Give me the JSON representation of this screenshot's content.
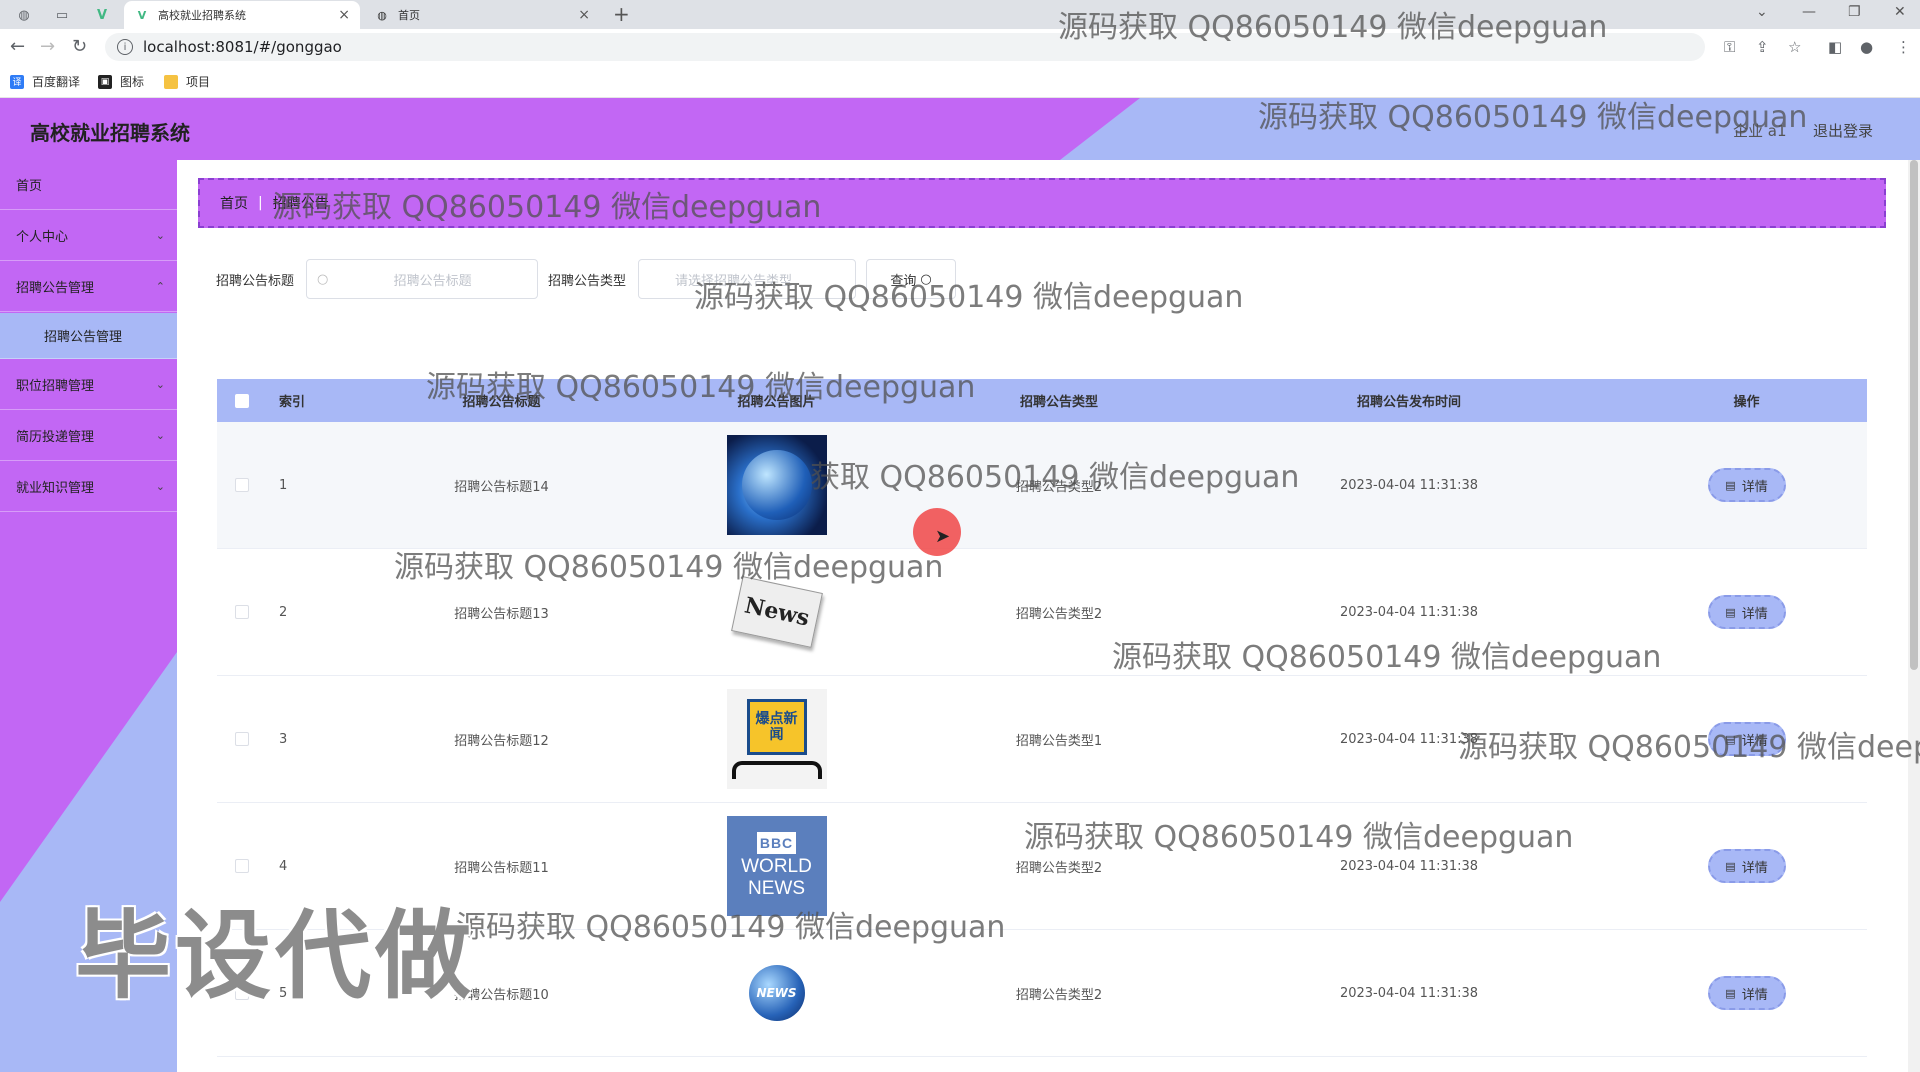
{
  "browser": {
    "tabs": [
      {
        "title": "高校就业招聘系统",
        "close": "×"
      },
      {
        "title": "首页",
        "close": "×"
      }
    ],
    "new_tab": "+",
    "url": "localhost:8081/#/gonggao",
    "bookmarks": [
      {
        "label": "百度翻译",
        "icon": "translate-icon",
        "color": "#2f7cf6"
      },
      {
        "label": "图标",
        "icon": "image-icon",
        "color": "#222222"
      },
      {
        "label": "项目",
        "icon": "folder-icon",
        "color": "#f5c242"
      }
    ]
  },
  "header": {
    "title": "高校就业招聘系统",
    "user": "企业 a1",
    "logout": "退出登录"
  },
  "sidebar": {
    "items": [
      {
        "label": "首页"
      },
      {
        "label": "个人中心"
      },
      {
        "label": "招聘公告管理"
      },
      {
        "label": "招聘公告管理"
      },
      {
        "label": "职位招聘管理"
      },
      {
        "label": "简历投递管理"
      },
      {
        "label": "就业知识管理"
      }
    ]
  },
  "breadcrumb": {
    "home": "首页",
    "current": "招聘公告"
  },
  "search": {
    "title_label": "招聘公告标题",
    "title_placeholder": "招聘公告标题",
    "type_label": "招聘公告类型",
    "type_placeholder": "请选择招聘公告类型",
    "button": "查询"
  },
  "table": {
    "headers": {
      "index": "索引",
      "title": "招聘公告标题",
      "image": "招聘公告图片",
      "type": "招聘公告类型",
      "time": "招聘公告发布时间",
      "op": "操作"
    },
    "rows": [
      {
        "index": "1",
        "title": "招聘公告标题14",
        "type": "招聘公告类型2",
        "time": "2023-04-04 11:31:38",
        "action": "详情"
      },
      {
        "index": "2",
        "title": "招聘公告标题13",
        "type": "招聘公告类型2",
        "time": "2023-04-04 11:31:38",
        "action": "详情"
      },
      {
        "index": "3",
        "title": "招聘公告标题12",
        "type": "招聘公告类型1",
        "time": "2023-04-04 11:31:38",
        "action": "详情"
      },
      {
        "index": "4",
        "title": "招聘公告标题11",
        "type": "招聘公告类型2",
        "time": "2023-04-04 11:31:38",
        "action": "详情"
      },
      {
        "index": "5",
        "title": "招聘公告标题10",
        "type": "招聘公告类型2",
        "time": "2023-04-04 11:31:38",
        "action": "详情"
      }
    ]
  },
  "images": {
    "row2_text": "News",
    "row3_text": "爆点新闻",
    "row4_brand": "BBC",
    "row4_text": "WORLD NEWS",
    "row5_text": "NEWS"
  },
  "watermarks": {
    "text": "源码获取 QQ86050149 微信deepguan",
    "partial_1": "获取 QQ86050149 微信deepguan",
    "partial_2": "源码获取 QQ86050149 微信deep",
    "big": "毕设代做"
  },
  "colors": {
    "primary": "#c267f4",
    "secondary": "#a8b8f6"
  }
}
